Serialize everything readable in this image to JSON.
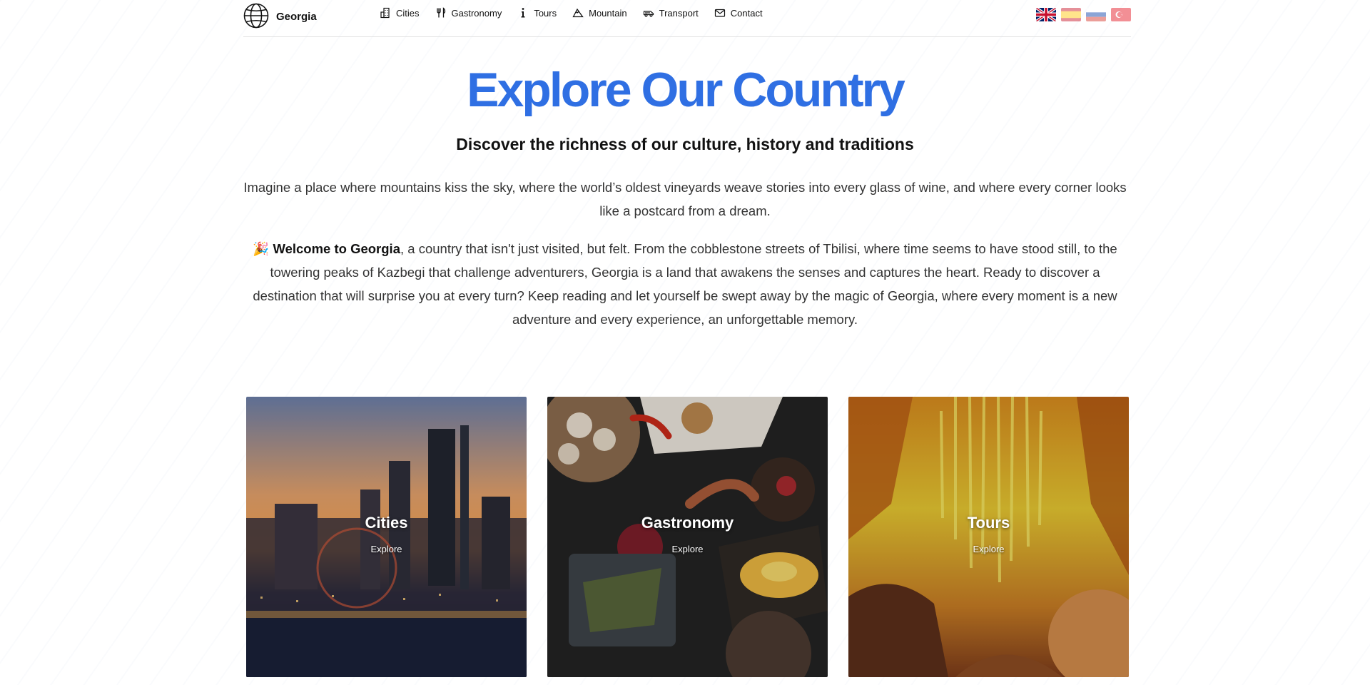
{
  "brand": {
    "name": "Georgia",
    "icon": "globe-icon"
  },
  "nav": {
    "items": [
      {
        "label": "Cities",
        "icon": "city-icon"
      },
      {
        "label": "Gastronomy",
        "icon": "cutlery-icon"
      },
      {
        "label": "Tours",
        "icon": "info-icon"
      },
      {
        "label": "Mountain",
        "icon": "mountain-icon"
      },
      {
        "label": "Transport",
        "icon": "car-icon"
      },
      {
        "label": "Contact",
        "icon": "mail-icon"
      }
    ]
  },
  "languages": [
    {
      "icon": "uk-flag-icon",
      "active": true
    },
    {
      "icon": "spain-flag-icon",
      "active": false
    },
    {
      "icon": "russia-flag-icon",
      "active": false
    },
    {
      "icon": "turkey-flag-icon",
      "active": false
    }
  ],
  "hero": {
    "title": "Explore Our Country",
    "subtitle": "Discover the richness of our culture, history and traditions",
    "intro": "Imagine a place where mountains kiss the sky, where the world’s oldest vineyards weave stories into every glass of wine, and where every corner looks like a postcard from a dream.",
    "welcome_emoji": "🎉",
    "welcome_bold": "Welcome to Georgia",
    "welcome_text": ", a country that isn't just visited, but felt. From the cobblestone streets of Tbilisi, where time seems to have stood still, to the towering peaks of Kazbegi that challenge adventurers, Georgia is a land that awakens the senses and captures the heart. Ready to discover a destination that will surprise you at every turn? Keep reading and let yourself be swept away by the magic of Georgia, where every moment is a new adventure and every experience, an unforgettable memory."
  },
  "cards": [
    {
      "title": "Cities",
      "link": "Explore"
    },
    {
      "title": "Gastronomy",
      "link": "Explore"
    },
    {
      "title": "Tours",
      "link": "Explore"
    }
  ],
  "colors": {
    "accent": "#2f6fe3",
    "text": "#333333",
    "border": "#e3e3e3"
  }
}
